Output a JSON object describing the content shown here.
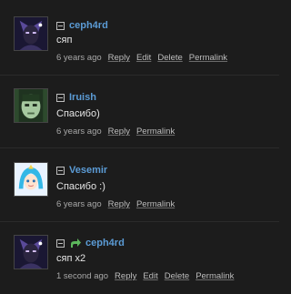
{
  "comments": [
    {
      "author": "ceph4rd",
      "text": "сяп",
      "time": "6 years ago",
      "actions": [
        "Reply",
        "Edit",
        "Delete",
        "Permalink"
      ],
      "reply_arrow": false,
      "avatar_icon": "purple-fantasy-character-avatar"
    },
    {
      "author": "Iruish",
      "text": "Спасибо)",
      "time": "6 years ago",
      "actions": [
        "Reply",
        "Permalink"
      ],
      "reply_arrow": false,
      "avatar_icon": "green-face-avatar"
    },
    {
      "author": "Vesemir",
      "text": "Спасибо :)",
      "time": "6 years ago",
      "actions": [
        "Reply",
        "Permalink"
      ],
      "reply_arrow": false,
      "avatar_icon": "anime-girl-avatar"
    },
    {
      "author": "ceph4rd",
      "text": "сяп x2",
      "time": "1 second ago",
      "actions": [
        "Reply",
        "Edit",
        "Delete",
        "Permalink"
      ],
      "reply_arrow": true,
      "avatar_icon": "purple-fantasy-character-avatar"
    }
  ],
  "colors": {
    "background": "#1c1c1c",
    "author_link": "#5b9bd5",
    "reply_arrow": "#5cb85c"
  }
}
